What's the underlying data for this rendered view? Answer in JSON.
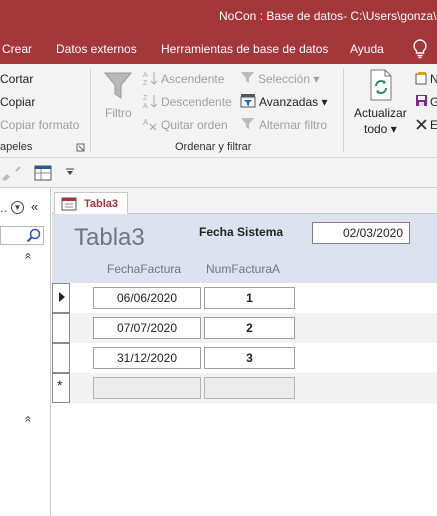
{
  "window": {
    "title": "NoCon : Base de datos- C:\\Users\\gonza\\D"
  },
  "ribbon_tabs": [
    "Crear",
    "Datos externos",
    "Herramientas de base de datos",
    "Ayuda"
  ],
  "clipboard": {
    "cut": "Cortar",
    "copy": "Copiar",
    "format": "Copiar formato",
    "group": "apeles"
  },
  "sort_filter": {
    "filter": "Filtro",
    "asc": "Ascendente",
    "desc": "Descendente",
    "remove_sort": "Quitar orden",
    "selection": "Selección",
    "advanced": "Avanzadas",
    "toggle_filter": "Alternar filtro",
    "group": "Ordenar y filtrar"
  },
  "records": {
    "refresh_line1": "Actualizar",
    "refresh_line2": "todo",
    "new_fragment": "N",
    "save_fragment": "G",
    "delete_fragment": "E"
  },
  "nav": {
    "title_fragment": "..",
    "collapse": "«",
    "chev_up": "«"
  },
  "doc_tab": "Tabla3",
  "form": {
    "title": "Tabla3",
    "fecha_label": "Fecha Sistema",
    "fecha_value": "02/03/2020",
    "col_fecha": "FechaFactura",
    "col_num": "NumFacturaA",
    "rows": [
      {
        "fecha": "06/06/2020",
        "num": "1"
      },
      {
        "fecha": "07/07/2020",
        "num": "2"
      },
      {
        "fecha": "31/12/2020",
        "num": "3"
      }
    ],
    "new_record_marker": "*"
  },
  "colors": {
    "accent": "#a4373a",
    "header_band": "#dde3ee",
    "ribbon_bg": "#f3f3f3"
  }
}
